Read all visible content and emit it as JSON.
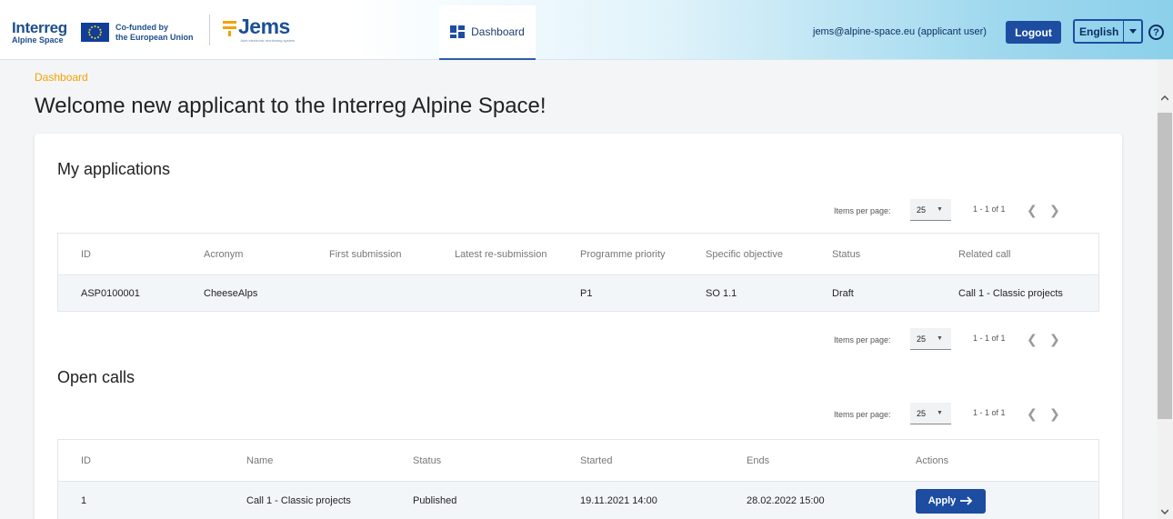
{
  "header": {
    "interreg_word": "Interreg",
    "interreg_sub": "Alpine Space",
    "eu_text_line1": "Co-funded by",
    "eu_text_line2": "the European Union",
    "jems_word": "Jems",
    "jems_tagline": "Joint electronic monitoring system",
    "nav_dashboard": "Dashboard",
    "user_email": "jems@alpine-space.eu (applicant user)",
    "logout_label": "Logout",
    "language": "English",
    "help_symbol": "?",
    "brand_color": "#1d4da1"
  },
  "breadcrumb": "Dashboard",
  "page_title": "Welcome new applicant to the Interreg Alpine Space!",
  "applications": {
    "title": "My applications",
    "paginator_top": {
      "items_per_page_label": "Items per page:",
      "items_per_page": "25",
      "range": "1 - 1 of 1"
    },
    "paginator_bottom": {
      "items_per_page_label": "Items per page:",
      "items_per_page": "25",
      "range": "1 - 1 of 1"
    },
    "columns": [
      "ID",
      "Acronym",
      "First submission",
      "Latest re-submission",
      "Programme priority",
      "Specific objective",
      "Status",
      "Related call"
    ],
    "rows": [
      [
        "ASP0100001",
        "CheeseAlps",
        "",
        "",
        "P1",
        "SO 1.1",
        "Draft",
        "Call 1 - Classic projects"
      ]
    ]
  },
  "open_calls": {
    "title": "Open calls",
    "paginator_top": {
      "items_per_page_label": "Items per page:",
      "items_per_page": "25",
      "range": "1 - 1 of 1"
    },
    "columns": [
      "ID",
      "Name",
      "Status",
      "Started",
      "Ends",
      "Actions"
    ],
    "rows": [
      {
        "id": "1",
        "name": "Call 1 - Classic projects",
        "status": "Published",
        "started": "19.11.2021 14:00",
        "ends": "28.02.2022 15:00",
        "action": "Apply"
      }
    ]
  }
}
